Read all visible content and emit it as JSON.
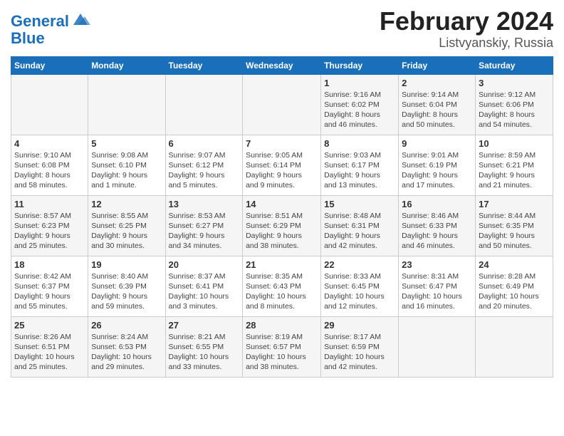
{
  "header": {
    "logo_line1": "General",
    "logo_line2": "Blue",
    "month": "February 2024",
    "location": "Listvyanskiy, Russia"
  },
  "weekdays": [
    "Sunday",
    "Monday",
    "Tuesday",
    "Wednesday",
    "Thursday",
    "Friday",
    "Saturday"
  ],
  "weeks": [
    [
      {
        "day": "",
        "info": ""
      },
      {
        "day": "",
        "info": ""
      },
      {
        "day": "",
        "info": ""
      },
      {
        "day": "",
        "info": ""
      },
      {
        "day": "1",
        "info": "Sunrise: 9:16 AM\nSunset: 6:02 PM\nDaylight: 8 hours\nand 46 minutes."
      },
      {
        "day": "2",
        "info": "Sunrise: 9:14 AM\nSunset: 6:04 PM\nDaylight: 8 hours\nand 50 minutes."
      },
      {
        "day": "3",
        "info": "Sunrise: 9:12 AM\nSunset: 6:06 PM\nDaylight: 8 hours\nand 54 minutes."
      }
    ],
    [
      {
        "day": "4",
        "info": "Sunrise: 9:10 AM\nSunset: 6:08 PM\nDaylight: 8 hours\nand 58 minutes."
      },
      {
        "day": "5",
        "info": "Sunrise: 9:08 AM\nSunset: 6:10 PM\nDaylight: 9 hours\nand 1 minute."
      },
      {
        "day": "6",
        "info": "Sunrise: 9:07 AM\nSunset: 6:12 PM\nDaylight: 9 hours\nand 5 minutes."
      },
      {
        "day": "7",
        "info": "Sunrise: 9:05 AM\nSunset: 6:14 PM\nDaylight: 9 hours\nand 9 minutes."
      },
      {
        "day": "8",
        "info": "Sunrise: 9:03 AM\nSunset: 6:17 PM\nDaylight: 9 hours\nand 13 minutes."
      },
      {
        "day": "9",
        "info": "Sunrise: 9:01 AM\nSunset: 6:19 PM\nDaylight: 9 hours\nand 17 minutes."
      },
      {
        "day": "10",
        "info": "Sunrise: 8:59 AM\nSunset: 6:21 PM\nDaylight: 9 hours\nand 21 minutes."
      }
    ],
    [
      {
        "day": "11",
        "info": "Sunrise: 8:57 AM\nSunset: 6:23 PM\nDaylight: 9 hours\nand 25 minutes."
      },
      {
        "day": "12",
        "info": "Sunrise: 8:55 AM\nSunset: 6:25 PM\nDaylight: 9 hours\nand 30 minutes."
      },
      {
        "day": "13",
        "info": "Sunrise: 8:53 AM\nSunset: 6:27 PM\nDaylight: 9 hours\nand 34 minutes."
      },
      {
        "day": "14",
        "info": "Sunrise: 8:51 AM\nSunset: 6:29 PM\nDaylight: 9 hours\nand 38 minutes."
      },
      {
        "day": "15",
        "info": "Sunrise: 8:48 AM\nSunset: 6:31 PM\nDaylight: 9 hours\nand 42 minutes."
      },
      {
        "day": "16",
        "info": "Sunrise: 8:46 AM\nSunset: 6:33 PM\nDaylight: 9 hours\nand 46 minutes."
      },
      {
        "day": "17",
        "info": "Sunrise: 8:44 AM\nSunset: 6:35 PM\nDaylight: 9 hours\nand 50 minutes."
      }
    ],
    [
      {
        "day": "18",
        "info": "Sunrise: 8:42 AM\nSunset: 6:37 PM\nDaylight: 9 hours\nand 55 minutes."
      },
      {
        "day": "19",
        "info": "Sunrise: 8:40 AM\nSunset: 6:39 PM\nDaylight: 9 hours\nand 59 minutes."
      },
      {
        "day": "20",
        "info": "Sunrise: 8:37 AM\nSunset: 6:41 PM\nDaylight: 10 hours\nand 3 minutes."
      },
      {
        "day": "21",
        "info": "Sunrise: 8:35 AM\nSunset: 6:43 PM\nDaylight: 10 hours\nand 8 minutes."
      },
      {
        "day": "22",
        "info": "Sunrise: 8:33 AM\nSunset: 6:45 PM\nDaylight: 10 hours\nand 12 minutes."
      },
      {
        "day": "23",
        "info": "Sunrise: 8:31 AM\nSunset: 6:47 PM\nDaylight: 10 hours\nand 16 minutes."
      },
      {
        "day": "24",
        "info": "Sunrise: 8:28 AM\nSunset: 6:49 PM\nDaylight: 10 hours\nand 20 minutes."
      }
    ],
    [
      {
        "day": "25",
        "info": "Sunrise: 8:26 AM\nSunset: 6:51 PM\nDaylight: 10 hours\nand 25 minutes."
      },
      {
        "day": "26",
        "info": "Sunrise: 8:24 AM\nSunset: 6:53 PM\nDaylight: 10 hours\nand 29 minutes."
      },
      {
        "day": "27",
        "info": "Sunrise: 8:21 AM\nSunset: 6:55 PM\nDaylight: 10 hours\nand 33 minutes."
      },
      {
        "day": "28",
        "info": "Sunrise: 8:19 AM\nSunset: 6:57 PM\nDaylight: 10 hours\nand 38 minutes."
      },
      {
        "day": "29",
        "info": "Sunrise: 8:17 AM\nSunset: 6:59 PM\nDaylight: 10 hours\nand 42 minutes."
      },
      {
        "day": "",
        "info": ""
      },
      {
        "day": "",
        "info": ""
      }
    ]
  ]
}
